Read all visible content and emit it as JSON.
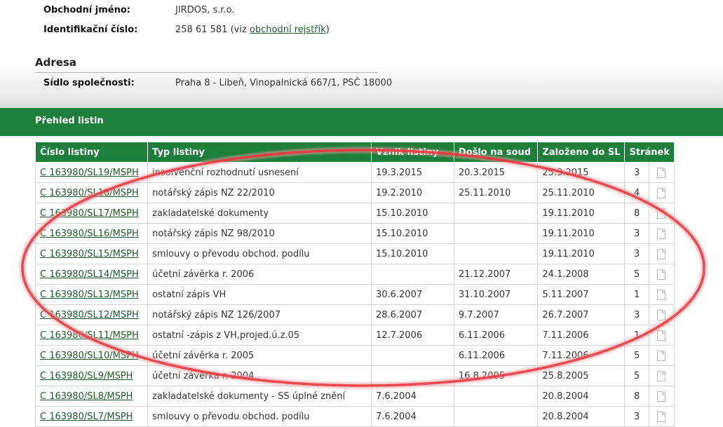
{
  "company": {
    "name_label": "Obchodní jméno:",
    "name_value": "JIRDOS, s.r.o.",
    "id_label": "Identifikační číslo:",
    "id_value": "258 61 581",
    "id_paren_open": "(viz ",
    "id_link": "obchodní rejstřík",
    "id_paren_close": ")"
  },
  "address": {
    "title": "Adresa",
    "seat_label": "Sídlo společnosti:",
    "seat_value": "Praha 8 - Libeň, Vinopalnická 667/1, PSČ 18000"
  },
  "section": {
    "title": "Přehled listin"
  },
  "table": {
    "headers": [
      "Číslo listiny",
      "Typ listiny",
      "Vznik listiny",
      "Došlo na soud",
      "Založeno do SL",
      "Stránek"
    ],
    "rows": [
      {
        "id": "C 163980/SL19/MSPH",
        "type": "insolvenční rozhodnutí usnesení",
        "created": "19.3.2015",
        "received": "20.3.2015",
        "filed": "25.3.2015",
        "pages": "3"
      },
      {
        "id": "C 163980/SL18/MSPH",
        "type": "notářský zápis NZ 22/2010",
        "created": "19.2.2010",
        "received": "25.11.2010",
        "filed": "25.11.2010",
        "pages": "4"
      },
      {
        "id": "C 163980/SL17/MSPH",
        "type": "zakladatelské dokumenty",
        "created": "15.10.2010",
        "received": "",
        "filed": "19.11.2010",
        "pages": "8"
      },
      {
        "id": "C 163980/SL16/MSPH",
        "type": "notářský zápis NZ 98/2010",
        "created": "15.10.2010",
        "received": "",
        "filed": "19.11.2010",
        "pages": "3"
      },
      {
        "id": "C 163980/SL15/MSPH",
        "type": "smlouvy o převodu obchod. podílu",
        "created": "15.10.2010",
        "received": "",
        "filed": "19.11.2010",
        "pages": "3"
      },
      {
        "id": "C 163980/SL14/MSPH",
        "type": "účetní závěrka r. 2006",
        "created": "",
        "received": "21.12.2007",
        "filed": "24.1.2008",
        "pages": "5"
      },
      {
        "id": "C 163980/SL13/MSPH",
        "type": "ostatní zápis VH",
        "created": "30.6.2007",
        "received": "31.10.2007",
        "filed": "5.11.2007",
        "pages": "1"
      },
      {
        "id": "C 163980/SL12/MSPH",
        "type": "notářský zápis NZ 126/2007",
        "created": "28.6.2007",
        "received": "9.7.2007",
        "filed": "26.7.2007",
        "pages": "3"
      },
      {
        "id": "C 163980/SL11/MSPH",
        "type": "ostatní -zápis z VH,projed.ú.z.05",
        "created": "12.7.2006",
        "received": "6.11.2006",
        "filed": "7.11.2006",
        "pages": "1"
      },
      {
        "id": "C 163980/SL10/MSPH",
        "type": "účetní závěrka r. 2005",
        "created": "",
        "received": "6.11.2006",
        "filed": "7.11.2006",
        "pages": "5"
      },
      {
        "id": "C 163980/SL9/MSPH",
        "type": "účetní závěrka r. 2004",
        "created": "",
        "received": "16.8.2005",
        "filed": "25.8.2005",
        "pages": "5"
      },
      {
        "id": "C 163980/SL8/MSPH",
        "type": "zakladatelské dokumenty - SS úplné znění",
        "created": "7.6.2004",
        "received": "",
        "filed": "20.8.2004",
        "pages": "8"
      },
      {
        "id": "C 163980/SL7/MSPH",
        "type": "smlouvy o převodu obchod. podílu",
        "created": "7.6.2004",
        "received": "",
        "filed": "20.8.2004",
        "pages": "3"
      }
    ]
  },
  "icons": {
    "row_icon": "document-icon",
    "annotation": "red-ellipse-highlight"
  },
  "colors": {
    "accent_green": "#1e7f3b",
    "link_green": "#1f5a2a",
    "highlight_red": "#e8333a"
  }
}
